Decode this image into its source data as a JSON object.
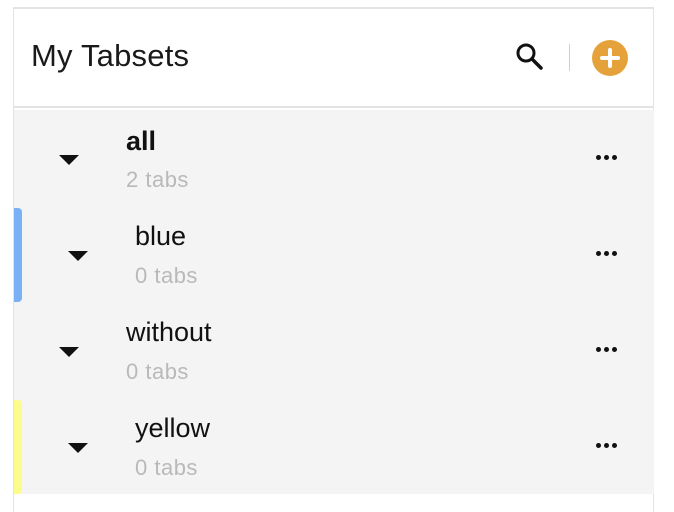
{
  "header": {
    "title": "My Tabsets",
    "search_icon": "search-icon",
    "add_icon": "plus-circle-icon",
    "accent": "#e5a23b"
  },
  "tabsets": [
    {
      "name": "all",
      "count": "2 tabs",
      "bold": true,
      "stripe_color": null
    },
    {
      "name": "blue",
      "count": "0 tabs",
      "bold": false,
      "stripe_color": "#7ab1f5"
    },
    {
      "name": "without",
      "count": "0 tabs",
      "bold": false,
      "stripe_color": null
    },
    {
      "name": "yellow",
      "count": "0 tabs",
      "bold": false,
      "stripe_color": "#fbfc8a"
    }
  ]
}
